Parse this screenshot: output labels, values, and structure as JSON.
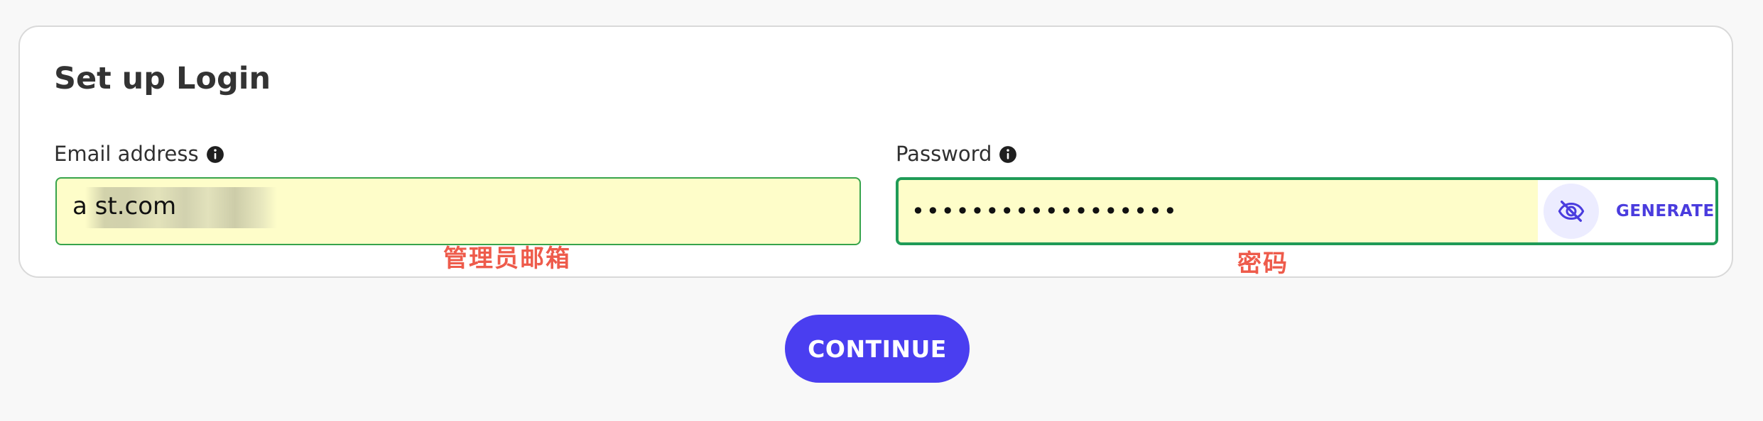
{
  "card": {
    "title": "Set up Login"
  },
  "email": {
    "label": "Email address",
    "value": "a st.com",
    "annotation": "管理员邮箱"
  },
  "password": {
    "label": "Password",
    "masked_value": "••••••••••••••••••",
    "annotation": "密码",
    "generate_label": "GENERATE"
  },
  "actions": {
    "continue_label": "CONTINUE"
  },
  "colors": {
    "background": "#f8f8f8",
    "card_background": "#ffffff",
    "input_fill": "#fefdc9",
    "email_border": "#37a44b",
    "password_border": "#1f9b57",
    "primary": "#4a3ef0",
    "annotation": "#ee5b4b",
    "generate_text": "#4a3cde"
  },
  "icons": {
    "info": "info-icon",
    "password_visibility": "eye-slash-icon"
  }
}
